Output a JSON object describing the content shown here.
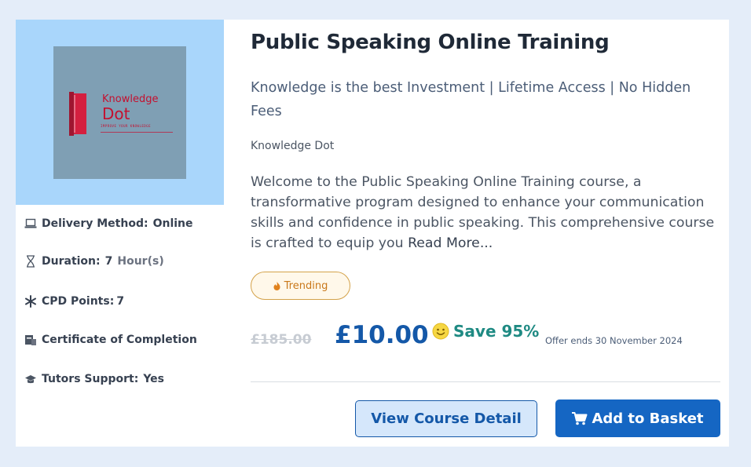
{
  "course": {
    "title": "Public Speaking Online Training",
    "subtitle": "Knowledge is the best Investment | Lifetime Access | No Hidden Fees",
    "provider": "Knowledge Dot",
    "description": "Welcome to the Public Speaking Online Training course, a transformative program designed to enhance your communication skills and confidence in public speaking. This comprehensive course is crafted to equip you",
    "read_more": "Read More...",
    "badge": "Trending"
  },
  "logo": {
    "line1": "Knowledge",
    "line2": "Dot",
    "tagline": "IMPROVE YOUR KNOWLEDGE"
  },
  "meta": {
    "delivery_label": "Delivery Method:",
    "delivery_value": "Online",
    "duration_label": "Duration:",
    "duration_value": "7",
    "duration_unit": "Hour(s)",
    "cpd_label": "CPD Points:",
    "cpd_value": "7",
    "certificate_label": "Certificate of Completion",
    "tutor_label": "Tutors Support:",
    "tutor_value": "Yes"
  },
  "pricing": {
    "old_price": "£185.00",
    "price": "£10.00",
    "save": "Save 95%",
    "offer": "Offer ends 30 November 2024"
  },
  "actions": {
    "detail_label": "View Course Detail",
    "basket_label": "Add to Basket"
  },
  "colors": {
    "page_bg": "#e4edf9",
    "thumb_bg": "#a9d6fb",
    "price": "#1458a8",
    "save": "#1f8a83",
    "basket_button": "#1566c3",
    "badge_border": "#d4a24a"
  }
}
